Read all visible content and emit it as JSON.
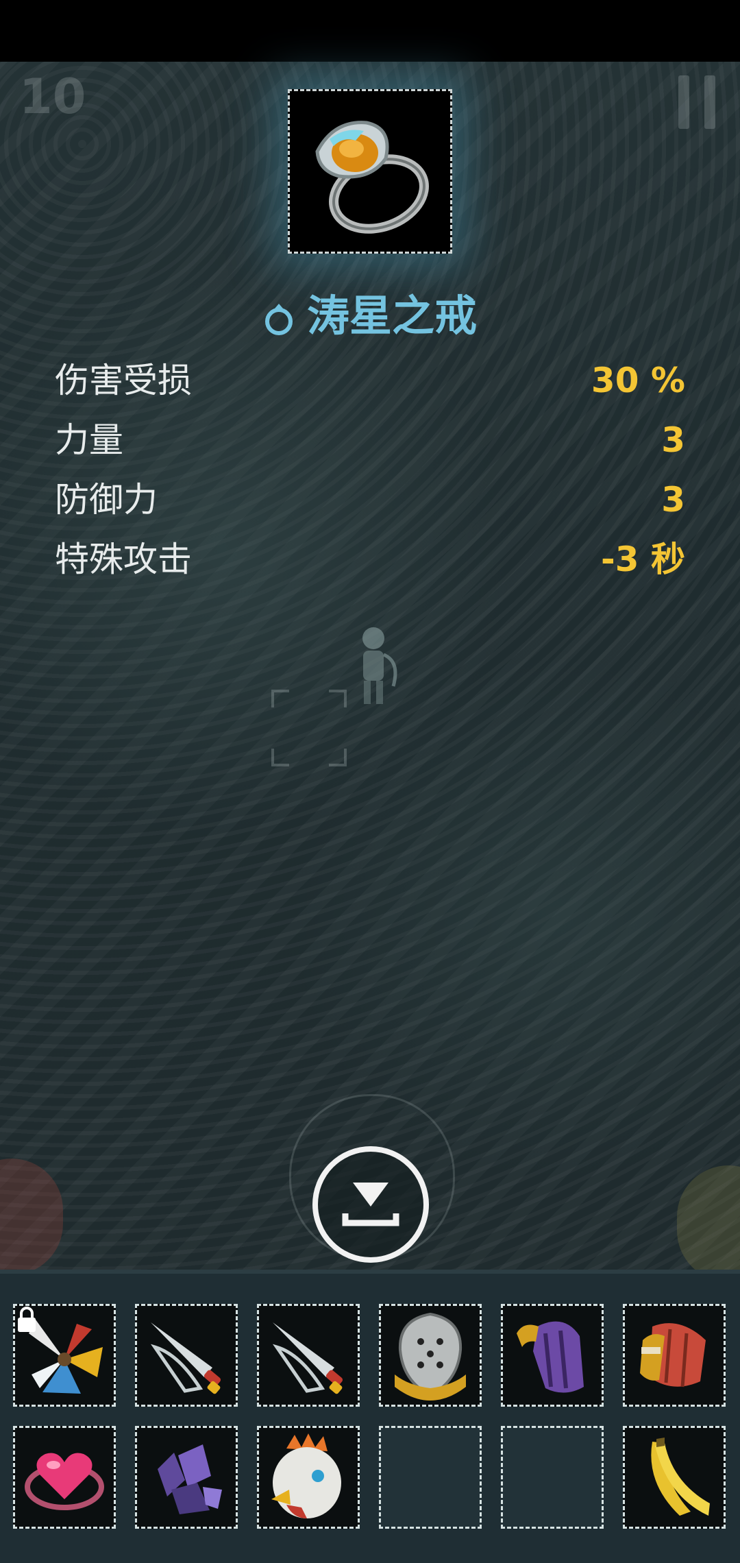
{
  "hud": {
    "level": "10",
    "pause_icon": "pause-icon"
  },
  "item": {
    "name": "涛星之戒",
    "type_icon": "ring-icon",
    "image": "ring-with-amber-gem"
  },
  "stats": [
    {
      "label": "伤害受损",
      "value": "30 %"
    },
    {
      "label": "力量",
      "value": "3"
    },
    {
      "label": "防御力",
      "value": "3"
    },
    {
      "label": "特殊攻击",
      "value": "-3 秒"
    }
  ],
  "drop_button": {
    "icon": "drop-down-icon"
  },
  "colors": {
    "item_name": "#74c3e0",
    "stat_value": "#f4c534",
    "stat_label": "#e8ecec",
    "inventory_bg": "#1f2e34"
  },
  "inventory": {
    "rows": [
      [
        {
          "item": "feathered-fan",
          "locked": true
        },
        {
          "item": "wing-blade"
        },
        {
          "item": "wing-blade"
        },
        {
          "item": "silver-shield"
        },
        {
          "item": "purple-gauntlet"
        },
        {
          "item": "red-armguard"
        }
      ],
      [
        {
          "item": "heart-amulet"
        },
        {
          "item": "purple-crystals"
        },
        {
          "item": "rooster-helmet"
        },
        {
          "item": ""
        },
        {
          "item": ""
        },
        {
          "item": "banana"
        }
      ]
    ]
  }
}
